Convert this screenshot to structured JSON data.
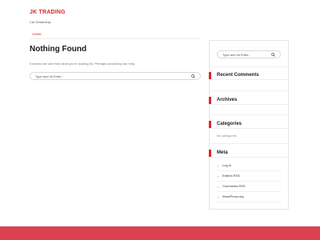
{
  "site": {
    "title": "JK TRADING",
    "tagline": "Car Dealership",
    "accent_color": "#d9272e"
  },
  "nav": {
    "items": [
      {
        "label": "HOME",
        "active": true
      }
    ]
  },
  "main": {
    "heading": "Nothing Found",
    "message": "It seems we can't find what you're looking for. Perhaps searching can help.",
    "search": {
      "placeholder": "Type and hit Enter..."
    }
  },
  "sidebar": {
    "search": {
      "placeholder": "Type and hit Enter..."
    },
    "widgets": {
      "recent_comments": {
        "title": "Recent Comments"
      },
      "archives": {
        "title": "Archives"
      },
      "categories": {
        "title": "Categories",
        "empty_text": "No categories"
      },
      "meta": {
        "title": "Meta",
        "items": [
          "Log in",
          "Entries RSS",
          "Comments RSS",
          "WordPress.org"
        ]
      }
    }
  },
  "icons": {
    "search": "search-icon",
    "chevron": "chevron-right-icon"
  },
  "footer": {
    "color": "#d9424e"
  }
}
